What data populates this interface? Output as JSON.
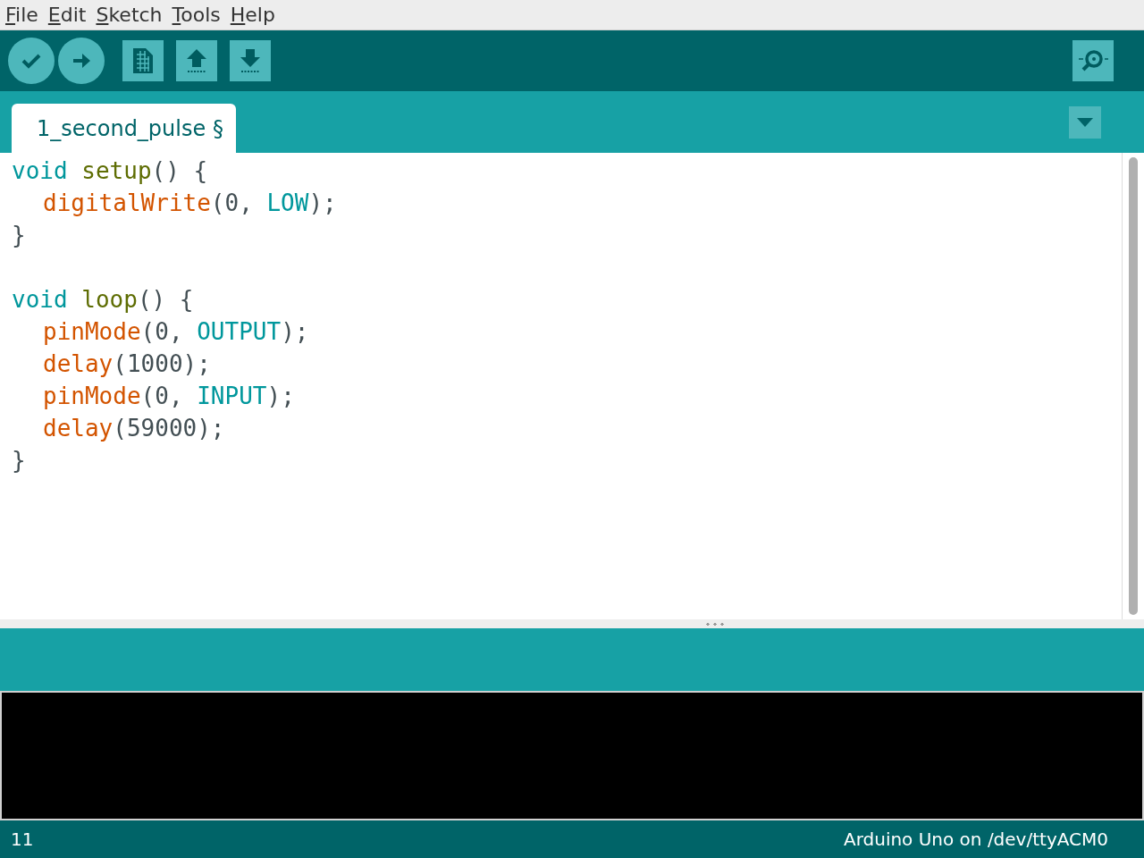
{
  "menu": [
    {
      "mnemonic": "F",
      "rest": "ile"
    },
    {
      "mnemonic": "E",
      "rest": "dit"
    },
    {
      "mnemonic": "S",
      "rest": "ketch"
    },
    {
      "mnemonic": "T",
      "rest": "ools"
    },
    {
      "mnemonic": "H",
      "rest": "elp"
    }
  ],
  "toolbar": [
    {
      "kind": "verify"
    },
    {
      "kind": "upload"
    },
    {
      "kind": "new"
    },
    {
      "kind": "open"
    },
    {
      "kind": "save"
    }
  ],
  "tabs": [
    {
      "label": "1_second_pulse §",
      "selected": true
    }
  ],
  "code": [
    {
      "kind": "code",
      "indented": false,
      "tokens": [
        {
          "kind": "type",
          "text": "void "
        },
        {
          "kind": "func",
          "text": "setup"
        },
        {
          "kind": "plain",
          "text": "() {"
        }
      ]
    },
    {
      "kind": "code",
      "indented": true,
      "tokens": [
        {
          "kind": "builtin",
          "text": "digitalWrite"
        },
        {
          "kind": "plain",
          "text": "(0, "
        },
        {
          "kind": "const",
          "text": "LOW"
        },
        {
          "kind": "plain",
          "text": ");"
        }
      ]
    },
    {
      "kind": "code",
      "indented": false,
      "tokens": [
        {
          "kind": "plain",
          "text": "}"
        }
      ]
    },
    {
      "kind": "blank"
    },
    {
      "kind": "code",
      "indented": false,
      "tokens": [
        {
          "kind": "type",
          "text": "void "
        },
        {
          "kind": "func",
          "text": "loop"
        },
        {
          "kind": "plain",
          "text": "() {"
        }
      ]
    },
    {
      "kind": "code",
      "indented": true,
      "tokens": [
        {
          "kind": "builtin",
          "text": "pinMode"
        },
        {
          "kind": "plain",
          "text": "(0, "
        },
        {
          "kind": "const",
          "text": "OUTPUT"
        },
        {
          "kind": "plain",
          "text": ");"
        }
      ]
    },
    {
      "kind": "code",
      "indented": true,
      "tokens": [
        {
          "kind": "builtin",
          "text": "delay"
        },
        {
          "kind": "plain",
          "text": "(1000);"
        }
      ]
    },
    {
      "kind": "code",
      "indented": true,
      "tokens": [
        {
          "kind": "builtin",
          "text": "pinMode"
        },
        {
          "kind": "plain",
          "text": "(0, "
        },
        {
          "kind": "const",
          "text": "INPUT"
        },
        {
          "kind": "plain",
          "text": ");"
        }
      ]
    },
    {
      "kind": "code",
      "indented": true,
      "tokens": [
        {
          "kind": "builtin",
          "text": "delay"
        },
        {
          "kind": "plain",
          "text": "(59000);"
        }
      ]
    },
    {
      "kind": "code",
      "indented": false,
      "tokens": [
        {
          "kind": "plain",
          "text": "}"
        }
      ]
    }
  ],
  "status_bar": {
    "line": "11",
    "board": "Arduino Uno on /dev/ttyACM0"
  }
}
